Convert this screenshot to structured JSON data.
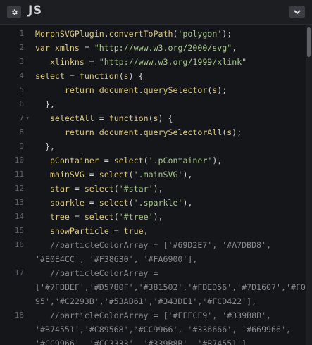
{
  "header": {
    "language": "JS",
    "settings_icon": "gear-icon",
    "collapse_icon": "chevron-down-icon"
  },
  "editor": {
    "lines": [
      {
        "n": "1",
        "segs": [
          [
            "k",
            "MorphSVGPlugin"
          ],
          [
            "p",
            "."
          ],
          [
            "k",
            "convertToPath"
          ],
          [
            "p",
            "("
          ],
          [
            "s",
            "'polygon'"
          ],
          [
            "p",
            ");"
          ]
        ]
      },
      {
        "n": "2",
        "segs": [
          [
            "k",
            "var xmlns "
          ],
          [
            "p",
            "= "
          ],
          [
            "s",
            "\"http://www.w3.org/2000/svg\""
          ],
          [
            "p",
            ","
          ]
        ]
      },
      {
        "n": "3",
        "segs": [
          [
            "k",
            "   xlinkns "
          ],
          [
            "p",
            "= "
          ],
          [
            "s",
            "\"http://www.w3.org/1999/xlink\""
          ]
        ]
      },
      {
        "n": "4",
        "segs": [
          [
            "k",
            "select "
          ],
          [
            "p",
            "= "
          ],
          [
            "k",
            "function"
          ],
          [
            "p",
            "("
          ],
          [
            "k",
            "s"
          ],
          [
            "p",
            ") {"
          ]
        ]
      },
      {
        "n": "5",
        "segs": [
          [
            "k",
            "      return document"
          ],
          [
            "p",
            "."
          ],
          [
            "k",
            "querySelector"
          ],
          [
            "p",
            "("
          ],
          [
            "k",
            "s"
          ],
          [
            "p",
            ");"
          ]
        ]
      },
      {
        "n": "6",
        "segs": [
          [
            "p",
            "  },"
          ]
        ]
      },
      {
        "n": "7",
        "fold": true,
        "segs": [
          [
            "k",
            "   selectAll "
          ],
          [
            "p",
            "= "
          ],
          [
            "k",
            "function"
          ],
          [
            "p",
            "("
          ],
          [
            "k",
            "s"
          ],
          [
            "p",
            ") {"
          ]
        ]
      },
      {
        "n": "8",
        "segs": [
          [
            "k",
            "      return document"
          ],
          [
            "p",
            "."
          ],
          [
            "k",
            "querySelectorAll"
          ],
          [
            "p",
            "("
          ],
          [
            "k",
            "s"
          ],
          [
            "p",
            ");"
          ]
        ]
      },
      {
        "n": "9",
        "segs": [
          [
            "p",
            "  },"
          ]
        ]
      },
      {
        "n": "10",
        "segs": [
          [
            "k",
            "   pContainer "
          ],
          [
            "p",
            "= "
          ],
          [
            "k",
            "select"
          ],
          [
            "p",
            "("
          ],
          [
            "s",
            "'.pContainer'"
          ],
          [
            "p",
            "),"
          ]
        ]
      },
      {
        "n": "11",
        "segs": [
          [
            "k",
            "   mainSVG "
          ],
          [
            "p",
            "= "
          ],
          [
            "k",
            "select"
          ],
          [
            "p",
            "("
          ],
          [
            "s",
            "'.mainSVG'"
          ],
          [
            "p",
            "),"
          ]
        ]
      },
      {
        "n": "12",
        "segs": [
          [
            "k",
            "   star "
          ],
          [
            "p",
            "= "
          ],
          [
            "k",
            "select"
          ],
          [
            "p",
            "("
          ],
          [
            "s",
            "'#star'"
          ],
          [
            "p",
            "),"
          ]
        ]
      },
      {
        "n": "13",
        "segs": [
          [
            "k",
            "   sparkle "
          ],
          [
            "p",
            "= "
          ],
          [
            "k",
            "select"
          ],
          [
            "p",
            "("
          ],
          [
            "s",
            "'.sparkle'"
          ],
          [
            "p",
            "),"
          ]
        ]
      },
      {
        "n": "14",
        "segs": [
          [
            "k",
            "   tree "
          ],
          [
            "p",
            "= "
          ],
          [
            "k",
            "select"
          ],
          [
            "p",
            "("
          ],
          [
            "s",
            "'#tree'"
          ],
          [
            "p",
            "),"
          ]
        ]
      },
      {
        "n": "15",
        "segs": [
          [
            "k",
            "   showParticle "
          ],
          [
            "p",
            "= "
          ],
          [
            "k",
            "true"
          ],
          [
            "p",
            ","
          ]
        ]
      },
      {
        "n": "16",
        "segs": [
          [
            "c",
            "   //particleColorArray = ['#69D2E7', '#A7DBD8',"
          ]
        ]
      },
      {
        "n": "",
        "segs": [
          [
            "c",
            "'#E0E4CC', '#F38630', '#FA6900'],"
          ]
        ]
      },
      {
        "n": "17",
        "segs": [
          [
            "c",
            "   //particleColorArray ="
          ]
        ]
      },
      {
        "n": "",
        "segs": [
          [
            "c",
            "['#7FBBEF','#D5780F','#381502','#FDED56','#7D1607','#F0C4"
          ]
        ]
      },
      {
        "n": "",
        "segs": [
          [
            "c",
            "95','#C2293B','#53AB61','#343DE1','#FCD422'],"
          ]
        ]
      },
      {
        "n": "18",
        "segs": [
          [
            "c",
            "   //particleColorArray = ['#FFFCF9', '#339B8B',"
          ]
        ]
      },
      {
        "n": "",
        "segs": [
          [
            "c",
            "'#B74551','#C89568','#CC9966', '#336666', '#669966',"
          ]
        ]
      },
      {
        "n": "",
        "segs": [
          [
            "c",
            "'#CC9966', '#CC3333', '#339B8B', '#B74551']"
          ]
        ]
      }
    ]
  },
  "colors": {
    "background": "#1d1e22",
    "editor_bg": "#151619",
    "keyword": "#ddca7e",
    "string": "#a8c78e",
    "comment": "#88898f",
    "line_number": "#5e6169"
  }
}
